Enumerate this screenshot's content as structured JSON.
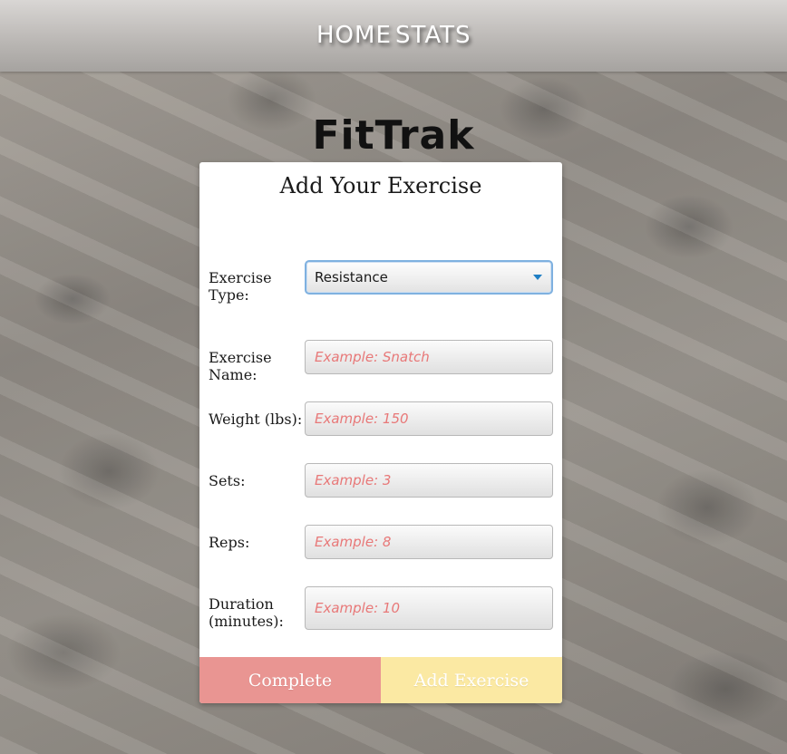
{
  "nav": {
    "home_label": "HOME",
    "stats_label": "STATS"
  },
  "app": {
    "title": "FitTrak"
  },
  "form": {
    "title": "Add Your Exercise",
    "exercise_type": {
      "label": "Exercise Type:",
      "value": "Resistance"
    },
    "exercise_name": {
      "label": "Exercise Name:",
      "placeholder": "Example: Snatch"
    },
    "weight": {
      "label": "Weight (lbs):",
      "placeholder": "Example: 150"
    },
    "sets": {
      "label": "Sets:",
      "placeholder": "Example: 3"
    },
    "reps": {
      "label": "Reps:",
      "placeholder": "Example: 8"
    },
    "duration": {
      "label": "Duration (minutes):",
      "placeholder": "Example: 10"
    },
    "complete_label": "Complete",
    "add_label": "Add Exercise"
  },
  "colors": {
    "complete_button": "#e99592",
    "add_button": "#fbe9a3",
    "placeholder": "#e87878",
    "select_focus": "#7fb1e0"
  },
  "icons": {
    "select_caret": "chevron-down-icon"
  }
}
